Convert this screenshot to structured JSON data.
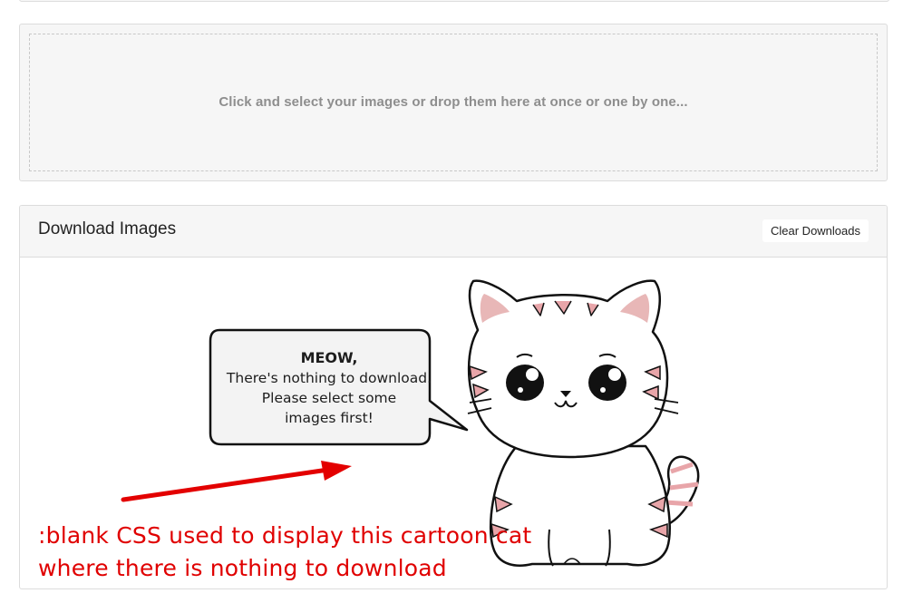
{
  "dropzone": {
    "text": "Click and select your images or drop them here at once or one by one..."
  },
  "downloads": {
    "title": "Download Images",
    "clear_label": "Clear Downloads"
  },
  "empty_state": {
    "bubble_title": "MEOW,",
    "bubble_lines": [
      "There's nothing to download.",
      "Please select some",
      "images first!"
    ],
    "illustration": "cartoon-cat"
  },
  "annotation": {
    "lines": [
      ":blank CSS used to display this cartoon cat",
      "where there is nothing to download"
    ],
    "color": "#e00000",
    "arrow": "red-arrow"
  }
}
